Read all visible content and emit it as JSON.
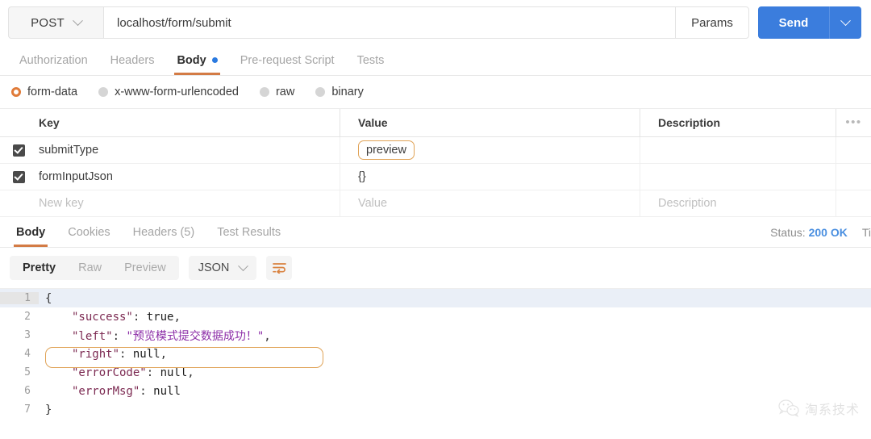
{
  "request": {
    "method": "POST",
    "url": "localhost/form/submit",
    "params_label": "Params",
    "send_label": "Send",
    "method_caret_icon": "chevron-down-icon",
    "send_caret_icon": "chevron-down-icon"
  },
  "request_tabs": [
    {
      "label": "Authorization",
      "active": false,
      "dot": false
    },
    {
      "label": "Headers",
      "active": false,
      "dot": false
    },
    {
      "label": "Body",
      "active": true,
      "dot": true
    },
    {
      "label": "Pre-request Script",
      "active": false,
      "dot": false
    },
    {
      "label": "Tests",
      "active": false,
      "dot": false
    }
  ],
  "body_types": [
    {
      "label": "form-data",
      "selected": true
    },
    {
      "label": "x-www-form-urlencoded",
      "selected": false
    },
    {
      "label": "raw",
      "selected": false
    },
    {
      "label": "binary",
      "selected": false
    }
  ],
  "kv_table": {
    "headers": {
      "key": "Key",
      "value": "Value",
      "description": "Description",
      "more_icon": "ellipsis-icon"
    },
    "rows": [
      {
        "checked": true,
        "key": "submitType",
        "value": "preview",
        "description": "",
        "value_highlighted": true
      },
      {
        "checked": true,
        "key": "formInputJson",
        "value": "{}",
        "description": "",
        "value_highlighted": false
      }
    ],
    "new_row": {
      "key_placeholder": "New key",
      "value_placeholder": "Value",
      "description_placeholder": "Description"
    }
  },
  "response_tabs": [
    {
      "label": "Body",
      "active": true
    },
    {
      "label": "Cookies",
      "active": false
    },
    {
      "label": "Headers (5)",
      "active": false
    },
    {
      "label": "Test Results",
      "active": false
    }
  ],
  "response_status": {
    "status_label": "Status:",
    "status_value": "200 OK",
    "time_label": "Ti"
  },
  "pretty_bar": {
    "modes": [
      {
        "label": "Pretty",
        "active": true
      },
      {
        "label": "Raw",
        "active": false
      },
      {
        "label": "Preview",
        "active": false
      }
    ],
    "format": "JSON",
    "format_caret_icon": "chevron-down-icon",
    "wrap_icon": "word-wrap-icon"
  },
  "code": {
    "lines": [
      {
        "n": "1",
        "active": true,
        "fold": true,
        "indent": 0,
        "tokens": [
          {
            "t": "{",
            "c": "k-pun"
          }
        ]
      },
      {
        "n": "2",
        "active": false,
        "fold": false,
        "indent": 1,
        "tokens": [
          {
            "t": "\"success\"",
            "c": "k-key"
          },
          {
            "t": ": ",
            "c": "k-pun"
          },
          {
            "t": "true",
            "c": "k-lit"
          },
          {
            "t": ",",
            "c": "k-pun"
          }
        ]
      },
      {
        "n": "3",
        "active": false,
        "fold": false,
        "indent": 1,
        "highlighted": true,
        "tokens": [
          {
            "t": "\"left\"",
            "c": "k-key"
          },
          {
            "t": ": ",
            "c": "k-pun"
          },
          {
            "t": "\"预览模式提交数据成功！\"",
            "c": "k-str"
          },
          {
            "t": ",",
            "c": "k-pun"
          }
        ]
      },
      {
        "n": "4",
        "active": false,
        "fold": false,
        "indent": 1,
        "tokens": [
          {
            "t": "\"right\"",
            "c": "k-key"
          },
          {
            "t": ": ",
            "c": "k-pun"
          },
          {
            "t": "null",
            "c": "k-lit"
          },
          {
            "t": ",",
            "c": "k-pun"
          }
        ]
      },
      {
        "n": "5",
        "active": false,
        "fold": false,
        "indent": 1,
        "tokens": [
          {
            "t": "\"errorCode\"",
            "c": "k-key"
          },
          {
            "t": ": ",
            "c": "k-pun"
          },
          {
            "t": "null",
            "c": "k-lit"
          },
          {
            "t": ",",
            "c": "k-pun"
          }
        ]
      },
      {
        "n": "6",
        "active": false,
        "fold": false,
        "indent": 1,
        "tokens": [
          {
            "t": "\"errorMsg\"",
            "c": "k-key"
          },
          {
            "t": ": ",
            "c": "k-pun"
          },
          {
            "t": "null",
            "c": "k-lit"
          }
        ]
      },
      {
        "n": "7",
        "active": false,
        "fold": false,
        "indent": 0,
        "tokens": [
          {
            "t": "}",
            "c": "k-pun"
          }
        ]
      }
    ]
  },
  "watermark": {
    "icon": "wechat-icon",
    "text": "淘系技术"
  },
  "colors": {
    "accent_orange": "#d37b45",
    "highlight_orange": "#e0a357",
    "send_blue": "#3b7ddd",
    "status_blue": "#4a8fe0",
    "radio_orange": "#e07b39",
    "dot_blue": "#2b7ae0"
  }
}
